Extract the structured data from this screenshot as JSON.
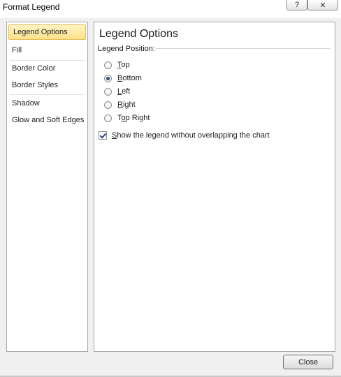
{
  "window": {
    "title": "Format Legend"
  },
  "titlebar_buttons": {
    "help": "?",
    "close": "✕"
  },
  "nav": {
    "items": [
      {
        "label": "Legend Options",
        "selected": true
      },
      {
        "label": "Fill",
        "selected": false
      },
      {
        "label": "Border Color",
        "selected": false
      },
      {
        "label": "Border Styles",
        "selected": false
      },
      {
        "label": "Shadow",
        "selected": false
      },
      {
        "label": "Glow and Soft Edges",
        "selected": false
      }
    ]
  },
  "content": {
    "heading": "Legend Options",
    "group_label": "Legend Position:",
    "positions": [
      {
        "label": "Top",
        "mnemonic": "T",
        "rest": "op",
        "checked": false
      },
      {
        "label": "Bottom",
        "mnemonic": "B",
        "rest": "ottom",
        "checked": true
      },
      {
        "label": "Left",
        "mnemonic": "L",
        "rest": "eft",
        "checked": false
      },
      {
        "label": "Right",
        "mnemonic": "R",
        "rest": "ight",
        "checked": false
      },
      {
        "label": "Top Right",
        "mnemonic": "o",
        "pre": "T",
        "rest": "p Right",
        "checked": false
      }
    ],
    "overlap_checkbox": {
      "mnemonic": "S",
      "rest": "how the legend without overlapping the chart",
      "checked": true
    }
  },
  "footer": {
    "close_label": "Close"
  }
}
